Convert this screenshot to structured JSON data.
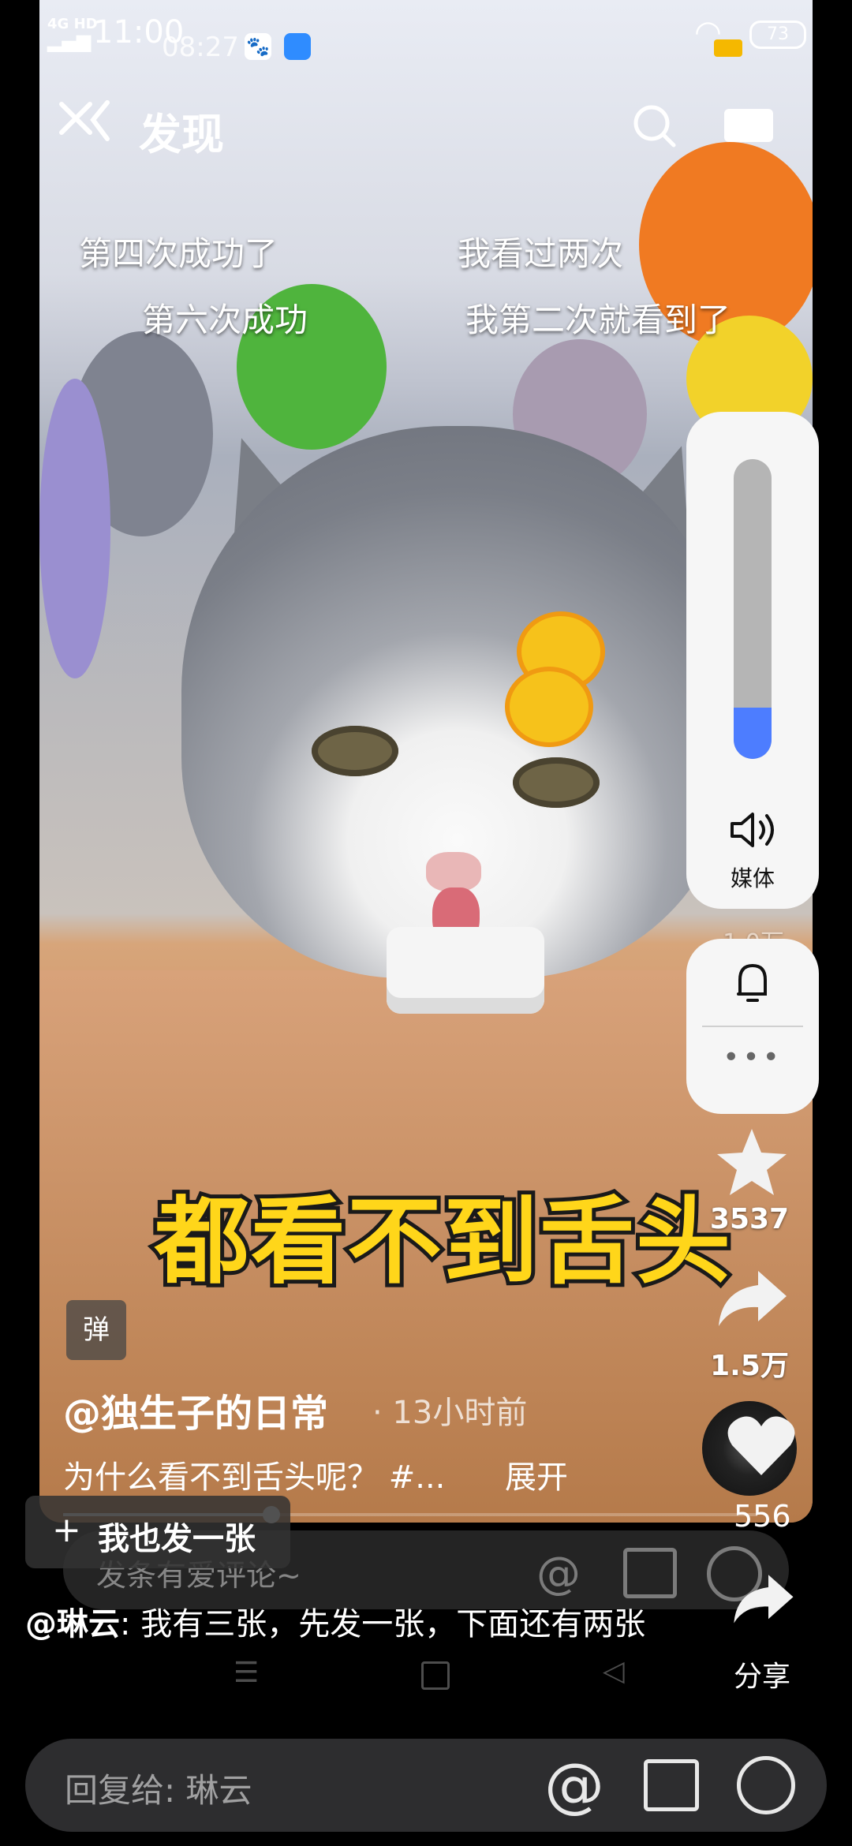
{
  "status_bar": {
    "time": "11:00",
    "overlay_time": "08:27",
    "network": "4G HD",
    "battery": "73"
  },
  "header": {
    "title": "发现"
  },
  "danmaku": [
    "第四次成功了",
    "我看过两次",
    "第六次成功",
    "我第二次就看到了"
  ],
  "video_caption": "都看不到舌头",
  "volume": {
    "label": "媒体",
    "level": 0.17
  },
  "counts_partial": "1.0万",
  "actions": {
    "favorites": "3537",
    "shares": "1.5万",
    "likes": "556",
    "share_label": "分享"
  },
  "post": {
    "effect_badge": "弹",
    "author": "@独生子的日常",
    "time_ago": "· 13小时前",
    "description": "为什么看不到舌头呢？ #...",
    "expand": "展开",
    "progress": 0.3
  },
  "comment_bar": {
    "placeholder": "发条有爱评论~"
  },
  "reply_chip": {
    "label": "我也发一张"
  },
  "comment": {
    "user": "@琳云",
    "text": ": 我有三张，先发一张，下面还有两张"
  },
  "reply_input": {
    "placeholder": "回复给: 琳云"
  },
  "colors": {
    "accent_blue": "#4d7dff",
    "caption_yellow": "#ffd61a"
  }
}
